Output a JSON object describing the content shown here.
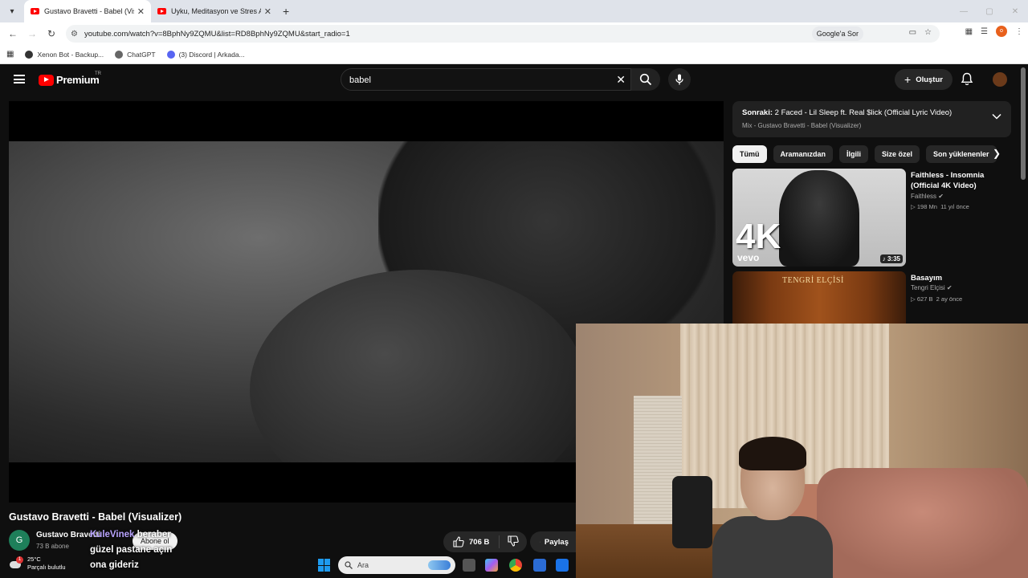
{
  "browser": {
    "tabs": [
      {
        "title": "Gustavo Bravetti - Babel (Visualizer)",
        "active": true
      },
      {
        "title": "Uyku, Meditasyon ve Stres Atma",
        "active": false
      }
    ],
    "url": "youtube.com/watch?v=8BphNy9ZQMU&list=RD8BphNy9ZQMU&start_radio=1",
    "google_ask": "Google'a Sor",
    "profile_letter": "o",
    "bookmarks": [
      {
        "label": "Xenon Bot - Backup...",
        "color": "#333333"
      },
      {
        "label": "ChatGPT",
        "color": "#555555"
      },
      {
        "label": "(3) Discord | Arkada...",
        "color": "#5865f2"
      }
    ]
  },
  "youtube": {
    "logo_word": "Premium",
    "region": "TR",
    "search_query": "babel",
    "create_label": "Oluştur",
    "video": {
      "title": "Gustavo Bravetti - Babel (Visualizer)",
      "channel_name": "Gustavo Bravetti",
      "channel_initial": "G",
      "subscribers": "73 B abone",
      "subscribe_label": "Abone ol",
      "likes": "706 B",
      "share_label": "Paylaş"
    },
    "chat_overlay": {
      "user": "KuleVinek",
      "text": "beraber güzel pastane açın ona gideriz"
    },
    "next_up": {
      "prefix": "Sonraki:",
      "title": "2 Faced - Lil Sleep ft. Real $lick (Official Lyric Video)",
      "subtitle": "Mix - Gustavo Bravetti - Babel (Visualizer)"
    },
    "chips": [
      "Tümü",
      "Aramanızdan",
      "İlgili",
      "Size özel",
      "Son yüklenenler"
    ],
    "recommendations": [
      {
        "title": "Faithless - Insomnia (Official 4K Video)",
        "channel": "Faithless",
        "views": "198 Mn",
        "age": "11 yıl önce",
        "duration": "3:35",
        "thumb_text": "4K",
        "thumb_brand": "vevo"
      },
      {
        "title": "Basayım",
        "channel": "Tengri Elçisi",
        "views": "627 B",
        "age": "2 ay önce",
        "thumb_text": "TENGRİ ELÇİSİ"
      }
    ]
  },
  "taskbar": {
    "temperature": "25°C",
    "weather": "Parçalı bulutlu",
    "weather_badge": "1",
    "search_placeholder": "Ara"
  }
}
